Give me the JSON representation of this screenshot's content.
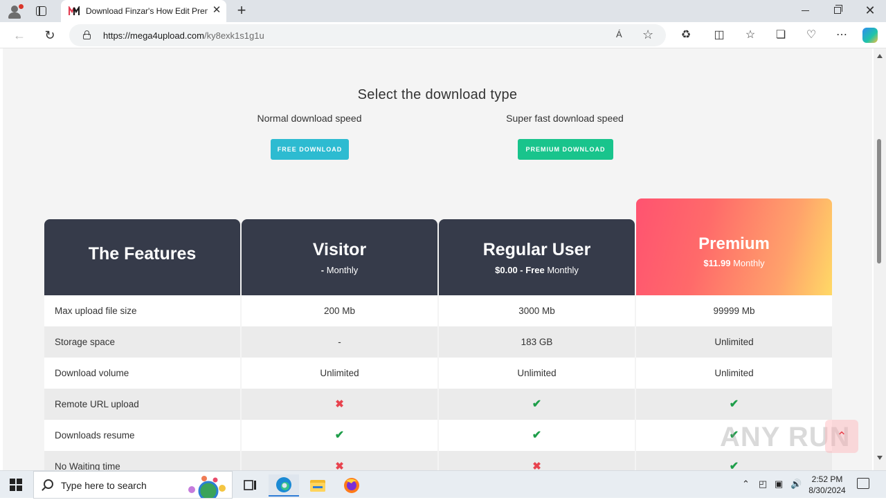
{
  "browser": {
    "tab_title": "Download Finzar's How Edit Premiere",
    "url_host": "https://mega4upload.com",
    "url_path": "/ky8exk1s1g1u",
    "read_aloud_icon": "Á",
    "new_tab_glyph": "+",
    "close_glyph": "✕"
  },
  "page": {
    "download_title": "Select the download type",
    "normal_speed": "Normal download speed",
    "super_speed": "Super fast download speed",
    "free_button": "FREE DOWNLOAD",
    "premium_button": "PREMIUM DOWNLOAD"
  },
  "pricing": {
    "features_title": "The Features",
    "plans": [
      {
        "name": "Visitor",
        "price_bold": "-",
        "price_rest": " Monthly"
      },
      {
        "name": "Regular User",
        "price_bold": "$0.00 - Free",
        "price_rest": " Monthly"
      },
      {
        "name": "Premium",
        "price_bold": "$11.99",
        "price_rest": " Monthly"
      }
    ],
    "rows": [
      {
        "feature": "Max upload file size",
        "values": [
          "200 Mb",
          "3000 Mb",
          "99999 Mb"
        ]
      },
      {
        "feature": "Storage space",
        "values": [
          "-",
          "183 GB",
          "Unlimited"
        ]
      },
      {
        "feature": "Download volume",
        "values": [
          "Unlimited",
          "Unlimited",
          "Unlimited"
        ]
      },
      {
        "feature": "Remote URL upload",
        "values": [
          "✖",
          "✔",
          "✔"
        ]
      },
      {
        "feature": "Downloads resume",
        "values": [
          "✔",
          "✔",
          "✔"
        ]
      },
      {
        "feature": "No Waiting time",
        "values": [
          "✖",
          "✖",
          "✔"
        ]
      }
    ],
    "colors": {
      "header_dark": "#363b4a",
      "premium_gradient_start": "#ff5370",
      "premium_gradient_end": "#ffd966",
      "yes": "#1e9e4a",
      "no": "#e8434e",
      "free_button": "#2dbbd1",
      "premium_button": "#19c48c"
    }
  },
  "watermark": "ANY RUN",
  "taskbar": {
    "search_placeholder": "Type here to search",
    "time": "2:52 PM",
    "date": "8/30/2024"
  }
}
